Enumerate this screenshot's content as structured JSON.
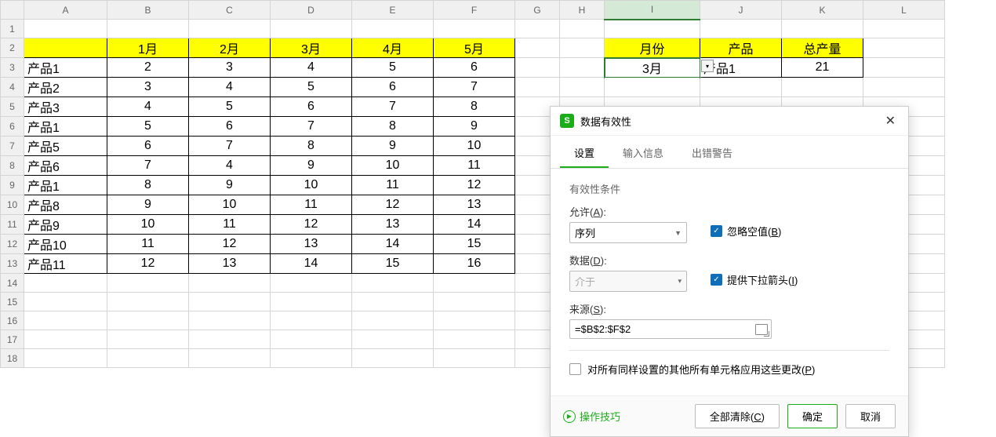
{
  "columns": [
    "A",
    "B",
    "C",
    "D",
    "E",
    "F",
    "G",
    "H",
    "I",
    "J",
    "K",
    "L"
  ],
  "row_count": 18,
  "main_table": {
    "header_row": 2,
    "headers": [
      "",
      "1月",
      "2月",
      "3月",
      "4月",
      "5月"
    ],
    "rows": [
      {
        "r": 3,
        "label": "产品1",
        "values": [
          "2",
          "3",
          "4",
          "5",
          "6"
        ]
      },
      {
        "r": 4,
        "label": "产品2",
        "values": [
          "3",
          "4",
          "5",
          "6",
          "7"
        ]
      },
      {
        "r": 5,
        "label": "产品3",
        "values": [
          "4",
          "5",
          "6",
          "7",
          "8"
        ]
      },
      {
        "r": 6,
        "label": "产品1",
        "values": [
          "5",
          "6",
          "7",
          "8",
          "9"
        ]
      },
      {
        "r": 7,
        "label": "产品5",
        "values": [
          "6",
          "7",
          "8",
          "9",
          "10"
        ]
      },
      {
        "r": 8,
        "label": "产品6",
        "values": [
          "7",
          "4",
          "9",
          "10",
          "11"
        ]
      },
      {
        "r": 9,
        "label": "产品1",
        "values": [
          "8",
          "9",
          "10",
          "11",
          "12"
        ]
      },
      {
        "r": 10,
        "label": "产品8",
        "values": [
          "9",
          "10",
          "11",
          "12",
          "13"
        ]
      },
      {
        "r": 11,
        "label": "产品9",
        "values": [
          "10",
          "11",
          "12",
          "13",
          "14"
        ]
      },
      {
        "r": 12,
        "label": "产品10",
        "values": [
          "11",
          "12",
          "13",
          "14",
          "15"
        ]
      },
      {
        "r": 13,
        "label": "产品11",
        "values": [
          "12",
          "13",
          "14",
          "15",
          "16"
        ]
      }
    ]
  },
  "summary_table": {
    "headers": {
      "I": "月份",
      "J": "产品",
      "K": "总产量"
    },
    "values": {
      "I": "3月",
      "J": "产品1",
      "K": "21"
    }
  },
  "selected_cell": "I3",
  "dialog": {
    "title": "数据有效性",
    "tabs": [
      "设置",
      "输入信息",
      "出错警告"
    ],
    "active_tab": 0,
    "section_title": "有效性条件",
    "allow_label": "允许(A):",
    "allow_value": "序列",
    "ignore_blank_label": "忽略空值(B)",
    "ignore_blank_checked": true,
    "data_label": "数据(D):",
    "data_value": "介于",
    "dropdown_label": "提供下拉箭头(I)",
    "dropdown_checked": true,
    "source_label": "来源(S):",
    "source_value": "=$B$2:$F$2",
    "apply_all_label": "对所有同样设置的其他所有单元格应用这些更改(P)",
    "apply_all_checked": false,
    "tips_label": "操作技巧",
    "clear_all_btn": "全部清除(C)",
    "ok_btn": "确定",
    "cancel_btn": "取消"
  }
}
